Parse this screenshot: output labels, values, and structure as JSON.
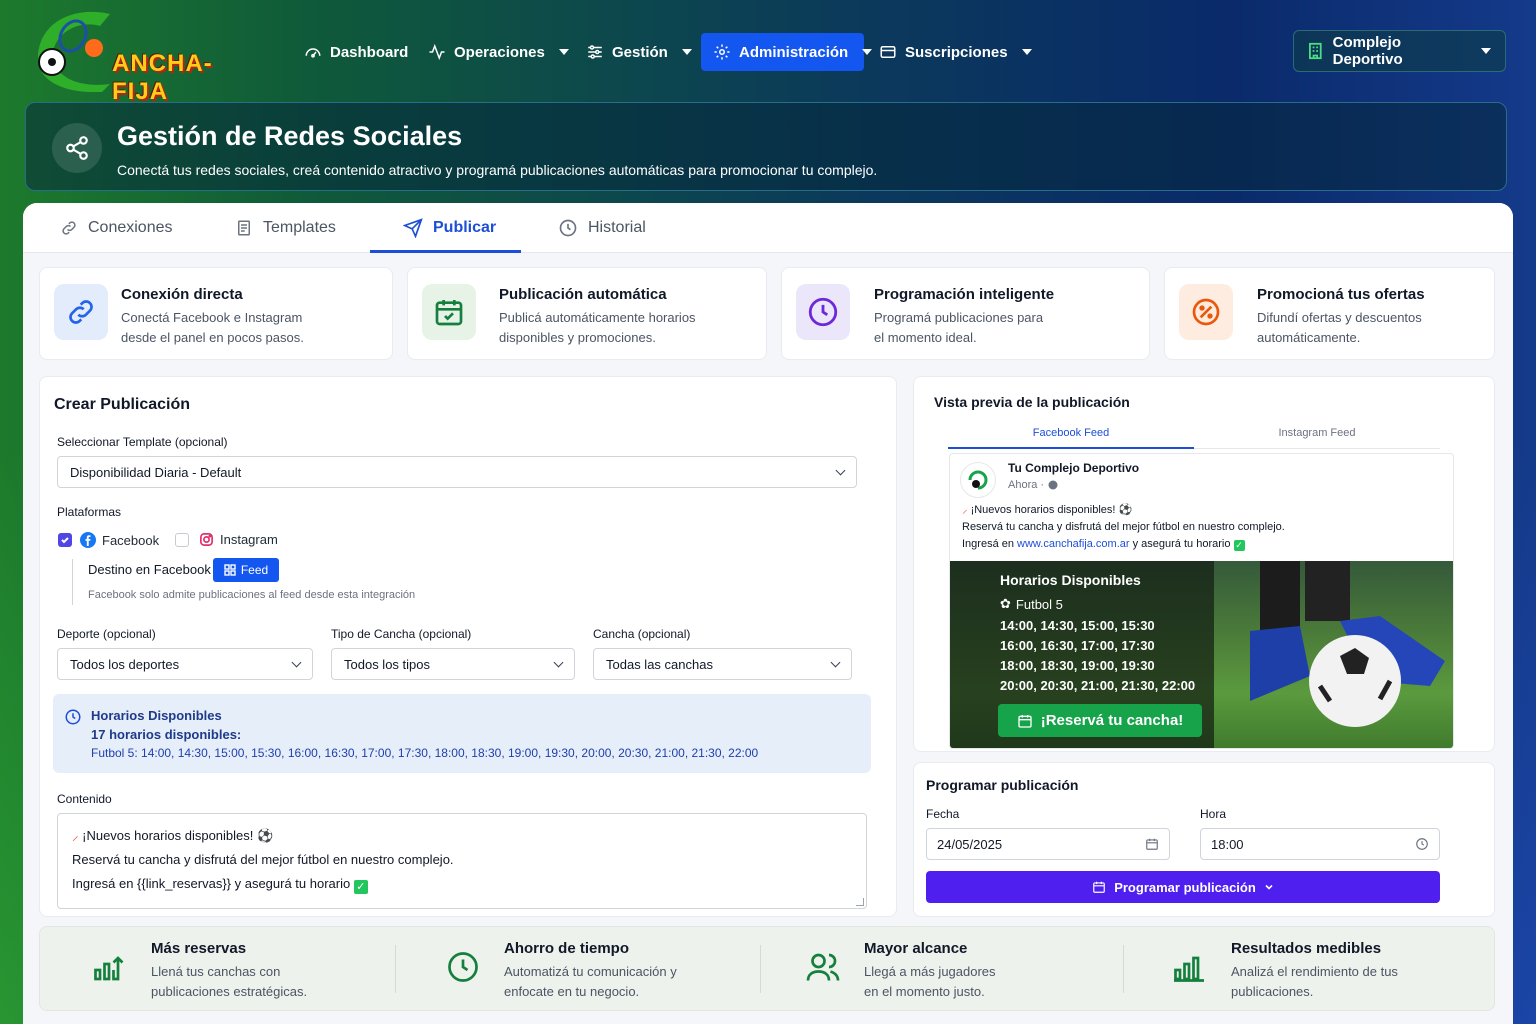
{
  "app": {
    "logo_text": "ANCHA-FIJA"
  },
  "nav": {
    "items": [
      {
        "label": "Dashboard"
      },
      {
        "label": "Operaciones"
      },
      {
        "label": "Gestión"
      },
      {
        "label": "Administración"
      },
      {
        "label": "Suscripciones"
      }
    ],
    "complejo_label": "Complejo Deportivo"
  },
  "header": {
    "title": "Gestión de Redes Sociales",
    "subtitle": "Conectá tus redes sociales, creá contenido atractivo y programá publicaciones automáticas para promocionar tu complejo."
  },
  "tabs": [
    {
      "label": "Conexiones"
    },
    {
      "label": "Templates"
    },
    {
      "label": "Publicar"
    },
    {
      "label": "Historial"
    }
  ],
  "features": [
    {
      "title": "Conexión directa",
      "desc1": "Conectá Facebook e Instagram",
      "desc2": "desde el panel en pocos pasos."
    },
    {
      "title": "Publicación automática",
      "desc1": "Publicá automáticamente horarios",
      "desc2": "disponibles y promociones."
    },
    {
      "title": "Programación inteligente",
      "desc1": "Programá publicaciones para",
      "desc2": "el momento ideal."
    },
    {
      "title": "Promocioná tus ofertas",
      "desc1": "Difundí ofertas y descuentos",
      "desc2": "automáticamente."
    }
  ],
  "crear": {
    "title": "Crear Publicación",
    "template_label": "Seleccionar Template (opcional)",
    "template_value": "Disponibilidad Diaria - Default",
    "plataformas_label": "Plataformas",
    "facebook_label": "Facebook",
    "facebook_checked": true,
    "instagram_label": "Instagram",
    "instagram_checked": false,
    "destino_label": "Destino en Facebook",
    "destino_value": "Feed",
    "destino_help": "Facebook solo admite publicaciones al feed desde esta integración",
    "deporte_label": "Deporte (opcional)",
    "deporte_value": "Todos los deportes",
    "tipo_label": "Tipo de Cancha (opcional)",
    "tipo_value": "Todos los tipos",
    "cancha_label": "Cancha (opcional)",
    "cancha_value": "Todas las canchas",
    "horarios_title": "Horarios Disponibles",
    "horarios_count": "17 horarios disponibles:",
    "horarios_list": "Futbol 5: 14:00, 14:30, 15:00, 15:30, 16:00, 16:30, 17:00, 17:30, 18:00, 18:30, 19:00, 19:30, 20:00, 20:30, 21:00, 21:30, 22:00",
    "contenido_label": "Contenido",
    "contenido_line1": "¡Nuevos horarios disponibles!",
    "contenido_line2": "Reservá tu cancha y disfrutá del mejor fútbol en nuestro complejo.",
    "contenido_line3": "Ingresá en {{link_reservas}} y asegurá tu horario"
  },
  "preview": {
    "title": "Vista previa de la publicación",
    "tab_facebook": "Facebook Feed",
    "tab_instagram": "Instagram Feed",
    "page_name": "Tu Complejo Deportivo",
    "time": "Ahora ·",
    "line1": "¡Nuevos horarios disponibles!",
    "line2": "Reservá tu cancha y disfrutá del mejor fútbol en nuestro complejo.",
    "line3_pre": "Ingresá en",
    "line3_link": "www.canchafija.com.ar",
    "line3_post": "y asegurá tu horario",
    "img_title": "Horarios Disponibles",
    "img_sport": "Futbol 5",
    "img_row1": "14:00, 14:30, 15:00, 15:30",
    "img_row2": "16:00, 16:30, 17:00, 17:30",
    "img_row3": "18:00, 18:30, 19:00, 19:30",
    "img_row4": "20:00, 20:30, 21:00, 21:30, 22:00",
    "img_cta": "¡Reservá tu cancha!"
  },
  "programar": {
    "title": "Programar publicación",
    "fecha_label": "Fecha",
    "fecha_value": "24/05/2025",
    "hora_label": "Hora",
    "hora_value": "18:00",
    "button_label": "Programar publicación"
  },
  "benefits": [
    {
      "title": "Más reservas",
      "desc1": "Llená tus canchas con",
      "desc2": "publicaciones estratégicas."
    },
    {
      "title": "Ahorro de tiempo",
      "desc1": "Automatizá tu comunicación y",
      "desc2": "enfocate en tu negocio."
    },
    {
      "title": "Mayor alcance",
      "desc1": "Llegá a más jugadores",
      "desc2": "en el momento justo."
    },
    {
      "title": "Resultados medibles",
      "desc1": "Analizá el rendimiento de tus",
      "desc2": "publicaciones."
    }
  ],
  "colors": {
    "primary": "#1456f0",
    "accent": "#4f1ff0",
    "success": "#22c55e"
  }
}
